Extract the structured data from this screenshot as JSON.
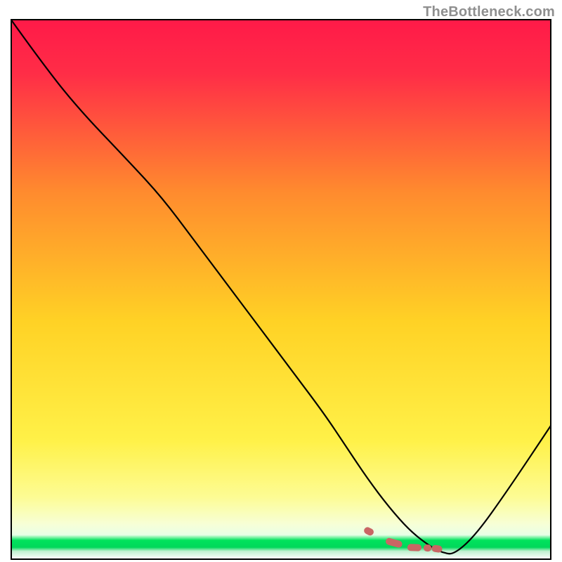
{
  "watermark": "TheBottleneck.com",
  "chart_data": {
    "type": "line",
    "title": "",
    "xlabel": "",
    "ylabel": "",
    "xlim": [
      0,
      100
    ],
    "ylim": [
      0,
      100
    ],
    "grid": false,
    "legend": false,
    "background_gradient": {
      "top": "#ff1a48",
      "mid_upper": "#ff8b2e",
      "mid": "#ffe025",
      "mid_lower": "#fdfc94",
      "green": "#00e35c",
      "bottom_fade": "#ffffff"
    },
    "series": [
      {
        "name": "bottleneck-curve",
        "style": "solid",
        "color": "#000000",
        "x": [
          0,
          5,
          12,
          22,
          28,
          34,
          40,
          46,
          52,
          58,
          62,
          66,
          70,
          74,
          78,
          80,
          82,
          86,
          92,
          100
        ],
        "y": [
          100,
          93,
          84,
          73.5,
          67,
          59,
          51,
          43,
          35,
          27,
          21,
          15,
          9.7,
          5.2,
          2.2,
          1.3,
          1.0,
          4.6,
          13,
          25
        ]
      },
      {
        "name": "optimal-band",
        "style": "dashed",
        "color": "#c96664",
        "x": [
          66,
          70,
          74,
          77,
          78.5,
          80
        ],
        "y": [
          5.4,
          3.4,
          2.3,
          2.2,
          2.1,
          1.9
        ]
      }
    ],
    "minimum_point": {
      "x": 81,
      "y": 1.0
    }
  }
}
